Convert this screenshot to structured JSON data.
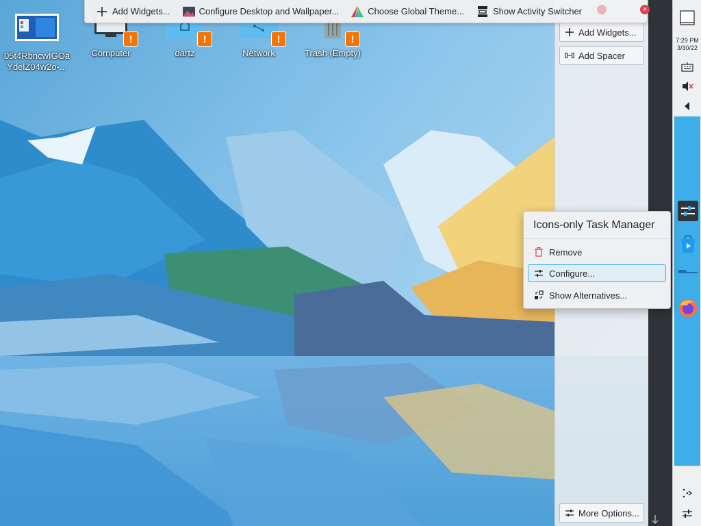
{
  "desktop_toolbar": {
    "add_widgets": "Add Widgets...",
    "configure_desktop": "Configure Desktop and Wallpaper...",
    "choose_theme": "Choose Global Theme...",
    "show_activity": "Show Activity Switcher"
  },
  "desktop_icons": [
    {
      "label": "05t4RbncwIGOaYdelZ04w2o-..."
    },
    {
      "label": "Computer"
    },
    {
      "label": "dartz"
    },
    {
      "label": "Network"
    },
    {
      "label": "Trash (Empty)"
    }
  ],
  "panel_edit": {
    "add_widgets": "Add Widgets...",
    "add_spacer": "Add Spacer",
    "more_options": "More Options..."
  },
  "panel": {
    "time": "7:29 PM",
    "date": "3/30/22"
  },
  "context_menu": {
    "title": "Icons-only Task Manager",
    "items": [
      {
        "label": "Remove",
        "icon": "trash-icon"
      },
      {
        "label": "Configure...",
        "icon": "configure-icon"
      },
      {
        "label": "Show Alternatives...",
        "icon": "alternatives-icon"
      }
    ]
  },
  "colors": {
    "accent": "#3daee9",
    "warning": "#f67400",
    "close": "#da4453",
    "panel_bg": "#eff0f1"
  }
}
